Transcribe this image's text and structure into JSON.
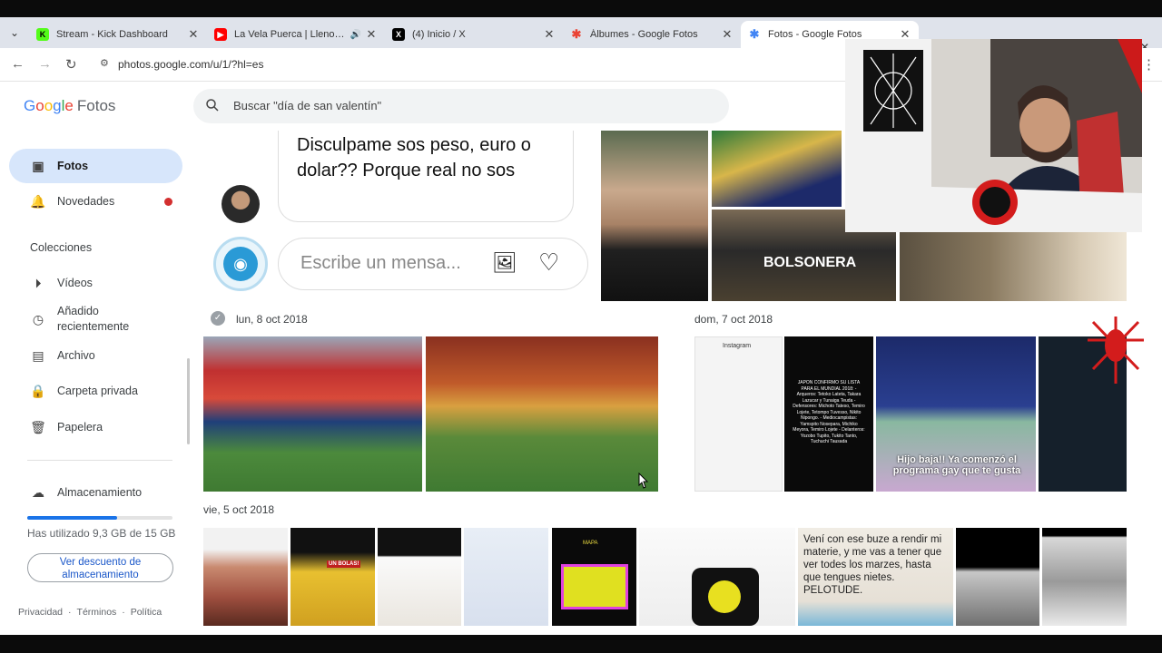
{
  "browser": {
    "tabs": [
      {
        "title": "Stream - Kick Dashboard",
        "favicon_color": "#53fc18",
        "favicon_text": "K"
      },
      {
        "title": "La Vela Puerca | Llenos de M",
        "favicon_color": "#ff0000",
        "favicon_text": "▶"
      },
      {
        "title": "(4) Inicio / X",
        "favicon_color": "#000000",
        "favicon_text": "X"
      },
      {
        "title": "Álbumes - Google Fotos",
        "favicon_color": "#fbbc05",
        "favicon_text": "✱"
      },
      {
        "title": "Fotos - Google Fotos",
        "favicon_color": "#4285f4",
        "favicon_text": "✱"
      }
    ],
    "url": "photos.google.com/u/1/?hl=es"
  },
  "app": {
    "logo_google": [
      "G",
      "o",
      "o",
      "g",
      "l",
      "e"
    ],
    "logo_product": "Fotos",
    "search_placeholder": "Buscar \"día de san valentín\""
  },
  "sidebar": {
    "items": [
      {
        "label": "Fotos",
        "icon": "photo-icon"
      },
      {
        "label": "Novedades",
        "icon": "bell-icon"
      }
    ],
    "collections_title": "Colecciones",
    "collections": [
      {
        "label": "Vídeos",
        "icon": "play-icon"
      },
      {
        "label": "Añadido recientemente",
        "icon": "clock-icon"
      },
      {
        "label": "Archivo",
        "icon": "archive-icon"
      },
      {
        "label": "Carpeta privada",
        "icon": "lock-icon"
      },
      {
        "label": "Papelera",
        "icon": "trash-icon"
      }
    ],
    "storage_label": "Almacenamiento",
    "storage_used_fraction": 0.62,
    "storage_text": "Has utilizado 9,3 GB de 15 GB",
    "storage_button": "Ver descuento de almacenamiento",
    "footer": [
      "Privacidad",
      "·",
      "Términos",
      "·",
      "Política"
    ]
  },
  "content": {
    "chat": {
      "bubble_text": "Disculpame sos peso, euro o dolar?? Porque real no sos",
      "input_placeholder": "Escribe un mensa..."
    },
    "top_photo_caption": "BOLSONERA",
    "dates": {
      "sat": "lun, 8 oct 2018",
      "sun": "dom, 7 oct 2018",
      "fri": "vie, 5 oct 2018"
    },
    "photos_text": {
      "meme_caption": "Hijo baja!! Ya comenzó el programa gay que te gusta",
      "japan_text": "JAPON CONFIRMO SU LISTA PARA EL MUNDIAL 2018: - Arqueros: Tetoko Lateta, Takara Lazucar y Tunaiga Teuda - Defensores: Michoto Tateso, Temiro Lojete, Tetompo Tuvesso, Nikito Nipongo. - Mediocampistas: Yamspito Nosepara, Michiko Meyora, Temiro Lojete - Delanteros: Yozobo Tupito, Tukito Tanto, Tuchuchi Tausada",
      "meme2_text": "Vení con ese buze a rendir mi materie, y me vas a tener que ver todes los marzes, hasta que tengues nietes. PELOTUDE.",
      "instagram": "Instagram",
      "game_title": "MAPA",
      "ma_text": "UN BOLAS!"
    }
  }
}
